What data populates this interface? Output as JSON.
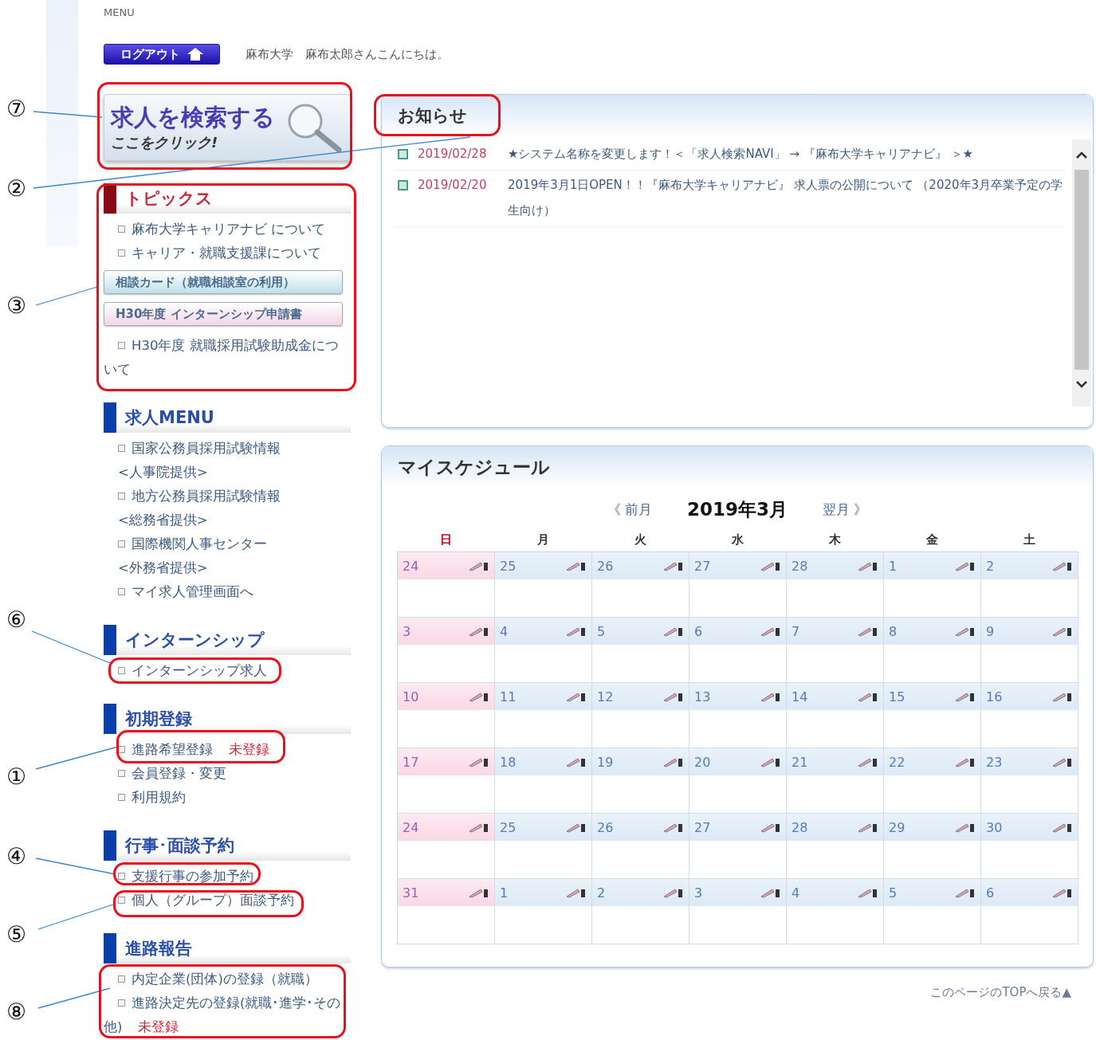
{
  "header": {
    "menu_label": "MENU",
    "logout_button": "ログアウト",
    "greeting": "麻布大学　麻布太郎さんこんにちは。"
  },
  "search_banner": {
    "title": "求人を検索する",
    "subtitle": "ここをクリック!"
  },
  "sidebar": {
    "sections": [
      {
        "kind": "topics",
        "title": "トピックス",
        "items": [
          {
            "kind": "link",
            "label": "麻布大学キャリアナビ について"
          },
          {
            "kind": "link",
            "label": "キャリア・就職支援課について"
          },
          {
            "kind": "button",
            "label": "相談カード（就職相談室の利用）",
            "color": "#bfe0e6"
          },
          {
            "kind": "button",
            "label": "H30年度 インターンシップ申請書",
            "color": "#f2d4e6"
          },
          {
            "kind": "link",
            "label": "H30年度 就職採用試験助成金について"
          }
        ]
      },
      {
        "kind": "menu",
        "title": "求人MENU",
        "items": [
          {
            "kind": "link",
            "label": "国家公務員採用試験情報",
            "note": "<人事院提供>"
          },
          {
            "kind": "link",
            "label": "地方公務員採用試験情報",
            "note": "<総務省提供>"
          },
          {
            "kind": "link",
            "label": "国際機関人事センター",
            "note": "<外務省提供>"
          },
          {
            "kind": "link",
            "label": "マイ求人管理画面へ"
          }
        ]
      },
      {
        "kind": "menu",
        "title": "インターンシップ",
        "items": [
          {
            "kind": "link",
            "label": "インターンシップ求人"
          }
        ]
      },
      {
        "kind": "menu",
        "title": "初期登録",
        "items": [
          {
            "kind": "link",
            "label": "進路希望登録",
            "status": "未登録"
          },
          {
            "kind": "link",
            "label": "会員登録・変更"
          },
          {
            "kind": "link",
            "label": "利用規約"
          }
        ]
      },
      {
        "kind": "menu",
        "title": "行事･面談予約",
        "items": [
          {
            "kind": "link",
            "label": "支援行事の参加予約"
          },
          {
            "kind": "link",
            "label": "個人（グループ）面談予約"
          }
        ]
      },
      {
        "kind": "menu",
        "title": "進路報告",
        "items": [
          {
            "kind": "link",
            "label": "内定企業(団体)の登録（就職）"
          },
          {
            "kind": "link",
            "label": "進路決定先の登録(就職･進学･その他)",
            "status": "未登録"
          }
        ]
      }
    ]
  },
  "news": {
    "title": "お知らせ",
    "items": [
      {
        "date": "2019/02/28",
        "text": "★システム名称を変更します！＜「求人検索NAVI」 → 『麻布大学キャリアナビ』 ＞★"
      },
      {
        "date": "2019/02/20",
        "text": "2019年3月1日OPEN！！『麻布大学キャリアナビ』 求人票の公開について （2020年3月卒業予定の学生向け）"
      }
    ]
  },
  "schedule": {
    "title": "マイスケジュール",
    "prev": "《 前月",
    "month": "2019年3月",
    "next": "翌月 》",
    "weekdays": [
      "日",
      "月",
      "火",
      "水",
      "木",
      "金",
      "土"
    ],
    "weeks": [
      [
        "24",
        "25",
        "26",
        "27",
        "28",
        "1",
        "2"
      ],
      [
        "3",
        "4",
        "5",
        "6",
        "7",
        "8",
        "9"
      ],
      [
        "10",
        "11",
        "12",
        "13",
        "14",
        "15",
        "16"
      ],
      [
        "17",
        "18",
        "19",
        "20",
        "21",
        "22",
        "23"
      ],
      [
        "24",
        "25",
        "26",
        "27",
        "28",
        "29",
        "30"
      ],
      [
        "31",
        "1",
        "2",
        "3",
        "4",
        "5",
        "6"
      ]
    ]
  },
  "footer_link": "このページのTOPへ戻る▲",
  "annotations": [
    {
      "label": "⑦"
    },
    {
      "label": "②"
    },
    {
      "label": "③"
    },
    {
      "label": "⑥"
    },
    {
      "label": "①"
    },
    {
      "label": "④"
    },
    {
      "label": "⑤"
    },
    {
      "label": "⑧"
    }
  ]
}
